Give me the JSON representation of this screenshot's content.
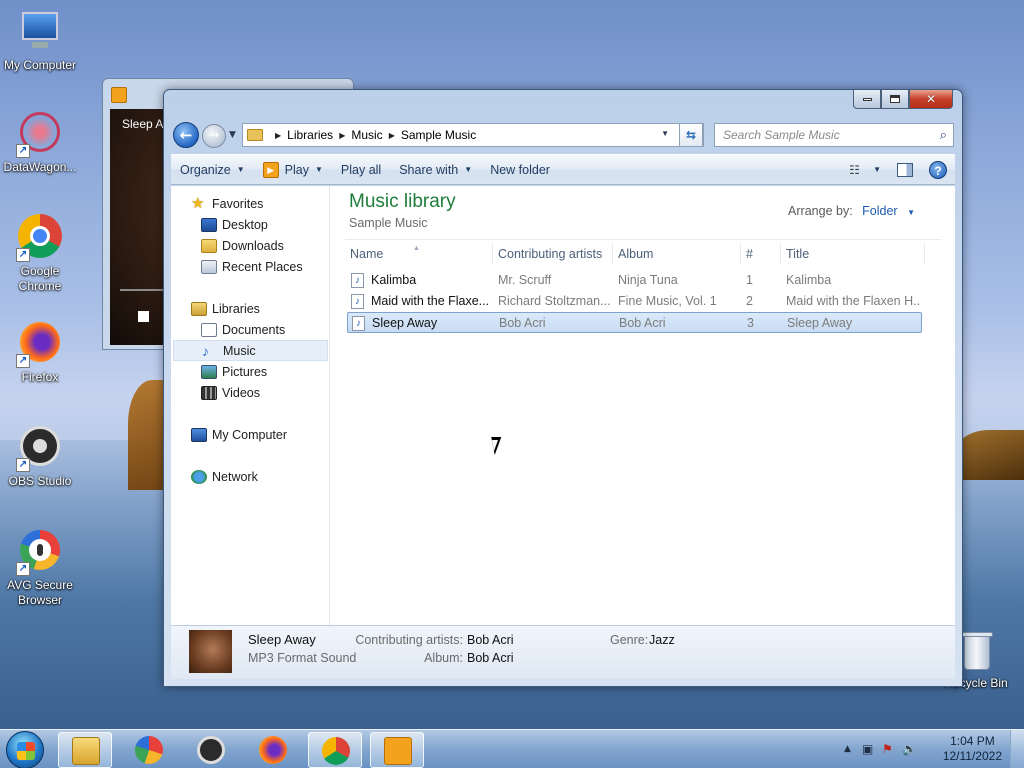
{
  "desktop": {
    "icons": [
      {
        "label": "My Computer",
        "icon": "my-computer-icon"
      },
      {
        "label": "DataWagon...",
        "icon": "datawagon-icon"
      },
      {
        "label": "Google Chrome",
        "icon": "chrome-icon"
      },
      {
        "label": "Firefox",
        "icon": "firefox-icon"
      },
      {
        "label": "OBS Studio",
        "icon": "obs-icon"
      },
      {
        "label": "AVG Secure Browser",
        "icon": "avg-browser-icon"
      },
      {
        "label": "Recycle Bin",
        "icon": "recycle-bin-icon"
      }
    ]
  },
  "media_window": {
    "title": "Sleep Av"
  },
  "explorer": {
    "address": {
      "crumbs": [
        "Libraries",
        "Music",
        "Sample Music"
      ]
    },
    "search": {
      "placeholder": "Search Sample Music"
    },
    "toolbar": {
      "organize": "Organize",
      "play": "Play",
      "play_all": "Play all",
      "share_with": "Share with",
      "new_folder": "New folder"
    },
    "nav": {
      "favorites": "Favorites",
      "desktop": "Desktop",
      "downloads": "Downloads",
      "recent_places": "Recent Places",
      "libraries": "Libraries",
      "documents": "Documents",
      "music": "Music",
      "pictures": "Pictures",
      "videos": "Videos",
      "my_computer": "My Computer",
      "network": "Network"
    },
    "content": {
      "title": "Music library",
      "subtitle": "Sample Music",
      "arrange_label": "Arrange by:",
      "arrange_value": "Folder",
      "columns": [
        "Name",
        "Contributing artists",
        "Album",
        "#",
        "Title"
      ],
      "rows": [
        {
          "name": "Kalimba",
          "artists": "Mr. Scruff",
          "album": "Ninja Tuna",
          "num": "1",
          "title": "Kalimba",
          "selected": false
        },
        {
          "name": "Maid with the Flaxe...",
          "artists": "Richard Stoltzman...",
          "album": "Fine Music, Vol. 1",
          "num": "2",
          "title": "Maid with the Flaxen H...",
          "selected": false
        },
        {
          "name": "Sleep Away",
          "artists": "Bob Acri",
          "album": "Bob Acri",
          "num": "3",
          "title": "Sleep Away",
          "selected": true
        }
      ]
    },
    "details": {
      "name": "Sleep Away",
      "type": "MP3 Format Sound",
      "artists_label": "Contributing artists:",
      "artists_value": "Bob Acri",
      "album_label": "Album:",
      "album_value": "Bob Acri",
      "genre_label": "Genre:",
      "genre_value": "Jazz"
    }
  },
  "taskbar": {
    "time": "1:04 PM",
    "date": "12/11/2022"
  },
  "colors": {
    "library_title": "#1e7d3a",
    "link_blue": "#1d5bb0",
    "selection": "#c7dcf5"
  }
}
